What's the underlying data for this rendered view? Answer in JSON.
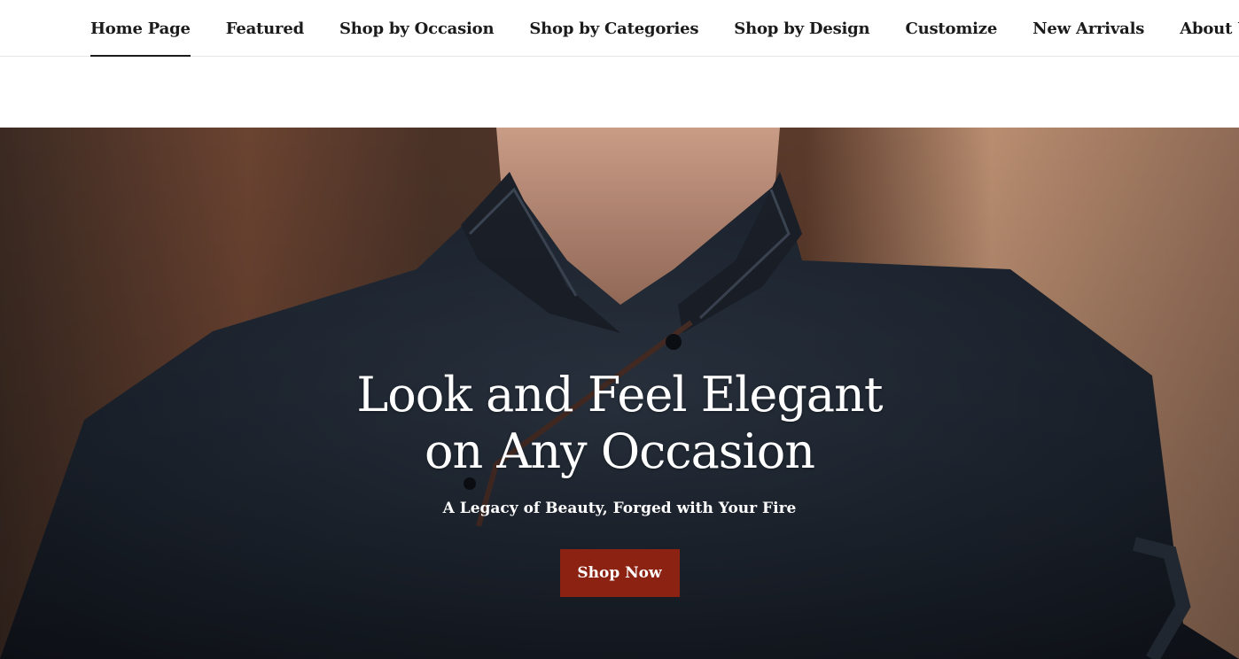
{
  "nav": {
    "items": [
      {
        "label": "Home Page",
        "active": true
      },
      {
        "label": "Featured",
        "active": false
      },
      {
        "label": "Shop by Occasion",
        "active": false
      },
      {
        "label": "Shop by Categories",
        "active": false
      },
      {
        "label": "Shop by Design",
        "active": false
      },
      {
        "label": "Customize",
        "active": false
      },
      {
        "label": "New Arrivals",
        "active": false
      },
      {
        "label": "About Us",
        "active": false
      }
    ]
  },
  "hero": {
    "title_line1": "Look and Feel Elegant",
    "title_line2": "on Any Occasion",
    "subtitle": "A Legacy of Beauty, Forged with Your Fire",
    "cta_label": "Shop Now"
  },
  "colors": {
    "cta_background": "#8c2312",
    "nav_text": "#1b1b1b",
    "hero_text": "#ffffff"
  }
}
